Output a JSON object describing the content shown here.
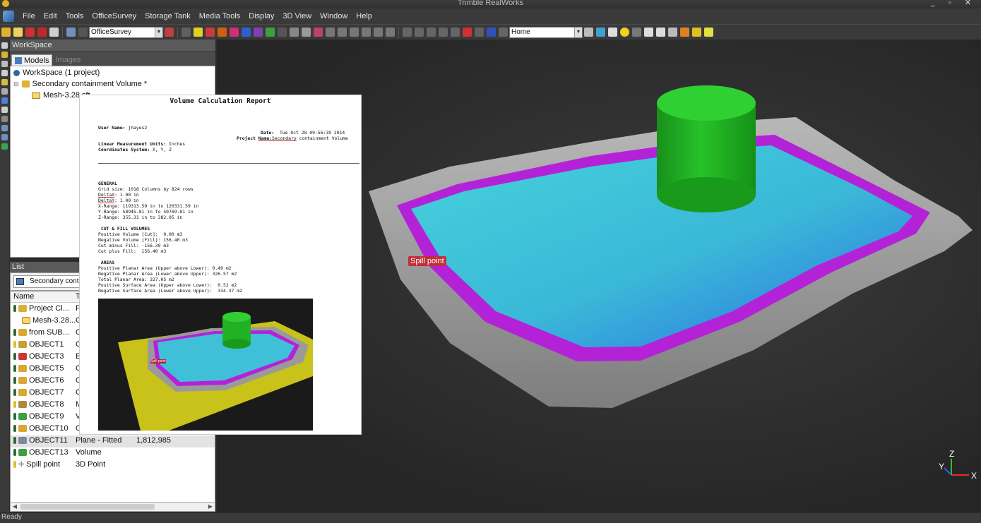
{
  "app": {
    "title": "Trimble RealWorks",
    "window_controls": "_ ▫ ✕"
  },
  "menu": {
    "items": [
      "File",
      "Edit",
      "Tools",
      "OfficeSurvey",
      "Storage Tank",
      "Media Tools",
      "Display",
      "3D View",
      "Window",
      "Help"
    ]
  },
  "toolbar": {
    "mode_select": "OfficeSurvey",
    "view_select": "Home"
  },
  "workspace": {
    "header": "WorkSpace",
    "tabs": [
      {
        "label": "Models"
      },
      {
        "label": "Images"
      }
    ],
    "tree": {
      "root": "WorkSpace  (1 project)",
      "project": "Secondary containment Volume  *",
      "child": "Mesh-3.28 sft"
    }
  },
  "list": {
    "header": "List",
    "selector": "Secondary containm",
    "columns": {
      "name": "Name",
      "type": "Type"
    },
    "rows": [
      {
        "name": "Project Cl...",
        "type": "Proj",
        "count": ""
      },
      {
        "name": "Mesh-3.28...",
        "type": "Grou",
        "count": ""
      },
      {
        "name": "from SUB...",
        "type": "Clou",
        "count": ""
      },
      {
        "name": "OBJECT1",
        "type": "Cylin",
        "count": ""
      },
      {
        "name": "OBJECT3",
        "type": "Extr",
        "count": ""
      },
      {
        "name": "OBJECT5",
        "type": "Clou",
        "count": ""
      },
      {
        "name": "OBJECT6",
        "type": "Clou",
        "count": ""
      },
      {
        "name": "OBJECT7",
        "type": "Clou",
        "count": ""
      },
      {
        "name": "OBJECT8",
        "type": "Mes",
        "count": ""
      },
      {
        "name": "OBJECT9",
        "type": "Volu",
        "count": ""
      },
      {
        "name": "OBJECT10",
        "type": "Clou",
        "count": ""
      },
      {
        "name": "OBJECT11",
        "type": "Plane - Fitted",
        "count": "1,812,985"
      },
      {
        "name": "OBJECT13",
        "type": "Volume",
        "count": ""
      },
      {
        "name": "Spill point",
        "type": "3D Point",
        "count": ""
      }
    ]
  },
  "status": {
    "text": "Ready"
  },
  "viewport": {
    "spill_label": "Spill point",
    "axis_labels": {
      "x": "X",
      "y": "Y",
      "z": "Z"
    }
  },
  "report": {
    "title": "Volume Calculation Report",
    "user_label": "User Name:",
    "user_value": "jhayes2",
    "date_label": "Date:",
    "date_value": "  Tue Oct 28 09:56:39 2014",
    "project_label": "Project ",
    "project_name_label": "Name:",
    "project_value_underlined": "Secondary",
    "project_value_rest": " containment Volume",
    "units_label": "Linear Measurement Units:",
    "units_value": " Inches",
    "coords_label": "Coordinates System:",
    "coords_value": " X, Y, Z",
    "general_header": "GENERAL",
    "grid_size": "Grid size: 1018 Columns by 824 rows",
    "deltax_label": "DeltaX",
    "deltax_value": ": 1.00 in",
    "deltay_label": "DeltaY",
    "deltay_value": ": 1.00 in",
    "x_range": "X-Range: 119313.59 in to 120331.59 in",
    "y_range": "Y-Range: 58945.81 in to 59769.81 in",
    "z_range": "Z-Range: 355.31 in to 382.05 in",
    "cutfill_header": " CUT & FILL VOLUMES",
    "pos_volume": "Positive Volume [Cut]:  0.00 m3",
    "neg_volume": "Negative Volume [Fill]: 156.40 m3",
    "cut_minus_fill": "Cut minus Fill: -156.39 m3",
    "cut_plus_fill": "Cut plus Fill:  156.40 m3",
    "areas_header": " AREAS",
    "pos_planar": "Positive Planar Area (Upper above Lower): 0.49 m2",
    "neg_planar": "Negative Planar Area (Lower above Upper): 326.57 m2",
    "total_planar": "Total Planar Area: 327.05 m2",
    "pos_surface": "Positive Surface Area (Upper above Lower):  0.52 m2",
    "neg_surface": "Negative Surface Area (Lower above Upper):  334.37 m2",
    "thumb_label": "Spill point"
  },
  "colors": {
    "cylinder": "#1fb21f",
    "water": "#3fc6d8",
    "rim": "#b422d8",
    "terrain": "#9a9a9a",
    "plane": "#c8c21a"
  },
  "icons": [
    "app-logo-icon",
    "new-icon",
    "open-icon",
    "save-icon",
    "print-icon",
    "undo-icon",
    "redo-icon",
    "folder-icon",
    "cloud-icon",
    "mesh-icon",
    "cylinder-icon",
    "volume-icon",
    "point-icon",
    "axis-icon"
  ]
}
